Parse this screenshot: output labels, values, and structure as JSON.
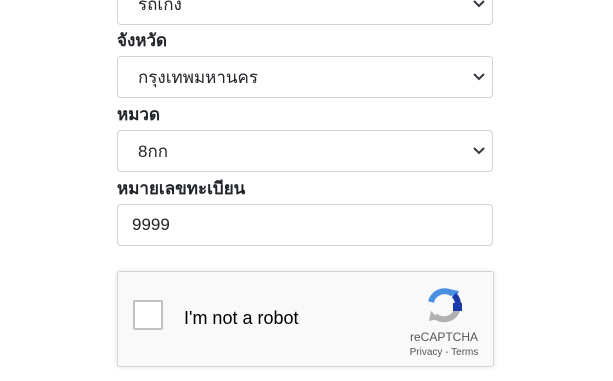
{
  "form": {
    "vehicle_type": {
      "value": "รถเก๋ง",
      "icon": "chevron-down-icon"
    },
    "province": {
      "label": "จังหวัด",
      "value": "กรุงเทพมหานคร",
      "icon": "chevron-down-icon"
    },
    "category": {
      "label": "หมวด",
      "value": "8กก",
      "icon": "chevron-down-icon"
    },
    "plate_number": {
      "label": "หมายเลขทะเบียน",
      "value": "9999"
    }
  },
  "captcha": {
    "checkbox_label": "I'm not a robot",
    "brand": "reCAPTCHA",
    "privacy_link": "Privacy",
    "separator": " - ",
    "terms_link": "Terms",
    "colors": {
      "blue": "#4a90e2",
      "dark_blue": "#1c3aa9",
      "gray": "#b1b1b1"
    }
  }
}
